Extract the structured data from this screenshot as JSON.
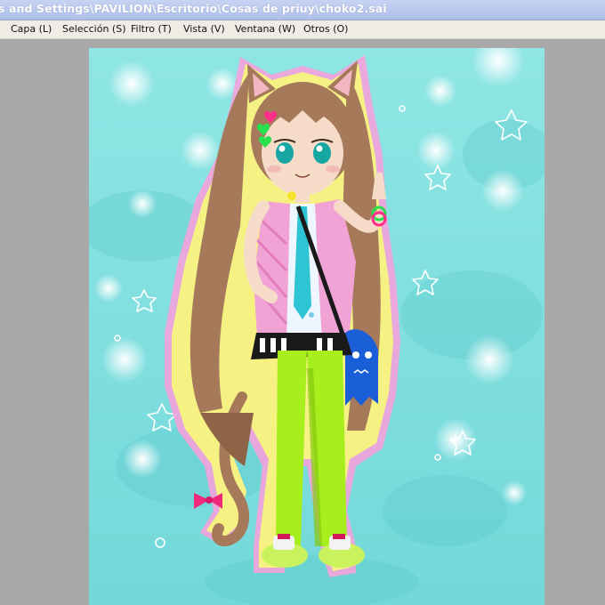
{
  "window": {
    "title": "s and Settings\\PAVILION\\Escritorio\\Cosas de priuy\\choko2.sai"
  },
  "menu": [
    {
      "id": "capa",
      "label": "Capa (L)"
    },
    {
      "id": "seleccion",
      "label": "Selección (S)"
    },
    {
      "id": "filtro",
      "label": "Filtro (T)"
    },
    {
      "id": "vista",
      "label": "Vista (V)"
    },
    {
      "id": "ventana",
      "label": "Ventana (W)"
    },
    {
      "id": "otros",
      "label": "Otros (O)"
    }
  ],
  "colors": {
    "title_bar": "#b9c8ee",
    "menu_bar": "#eeece4",
    "workspace": "#a9a9a9",
    "canvas_bg": "#7fdedd",
    "hair": "#a5795a",
    "jacket": "#f0a3d4",
    "pants": "#a6ee1c",
    "bag": "#1a5fd8",
    "outline_glow": "#f7f58a",
    "outline_pink": "#f39ad9"
  }
}
